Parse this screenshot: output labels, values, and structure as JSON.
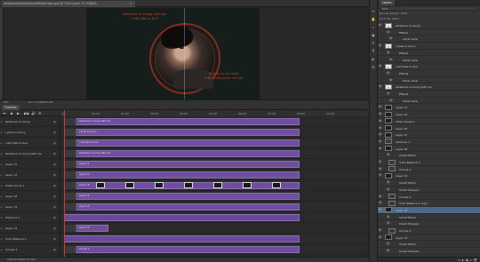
{
  "document": {
    "tab_title": "resistancefromtheeyetofthehorizon.psd @ 70% (Layer 13, RGB/8)",
    "close_glyph": "×"
  },
  "artwork": {
    "quote_top": "whatever is wrong with me\nI will take to bed",
    "quote_bottom": "lighter as we went\nwhere whatever we are"
  },
  "status": {
    "zoom": "70%",
    "doc": "Doc: 2.53M/92.1M"
  },
  "timeline": {
    "tab_label": "Timeline",
    "transport": [
      "⏮",
      "◀",
      "▶",
      "▶▶",
      "🔊",
      "⚙"
    ],
    "ruler_ticks": [
      "00",
      "01:00f",
      "02:00f",
      "03:00f",
      "04:00f",
      "05:00f",
      "06:00f",
      "07:00f",
      "08:00f",
      "09:00f"
    ],
    "time": "0:00:00:00",
    "fps": "(30.00 fps)",
    "tracks": [
      {
        "label": "whatever is wrong",
        "clip": "whatever is wrong with me"
      },
      {
        "label": "I grew to worry",
        "clip": "I grew to worry"
      },
      {
        "label": "I will take to bed",
        "clip": "I will take to bed"
      },
      {
        "label": "whatever is wrong with me",
        "clip": "whatever is wrong with me"
      },
      {
        "label": "Layer 11",
        "clip": "Layer 11"
      },
      {
        "label": "Layer 12",
        "clip": "Layer 12"
      },
      {
        "label": "Video Group 1",
        "clip": "Layer 18"
      },
      {
        "label": "Layer 16",
        "clip": "Layer 16"
      },
      {
        "label": "Layer 13",
        "clip": "Layer 13"
      },
      {
        "label": "Vibrance 1",
        "clip": ""
      },
      {
        "label": "Layer 14",
        "clip": "Layer 14"
      },
      {
        "label": "Color Balance 1",
        "clip": ""
      },
      {
        "label": "Curves 1",
        "clip": "Curves 1"
      }
    ]
  },
  "tools": [
    "↔",
    "✋",
    "⌕",
    "▣",
    "A",
    "¶",
    "◐",
    "⚙"
  ],
  "layers": {
    "tab_label": "Layers",
    "filter": "Kind",
    "blend": "Normal      Opacity: 100%",
    "lock": "Lock:        Fill: 100%",
    "footer": "fx  ◐  ▣  ▭  🗑",
    "rows": [
      {
        "name": "whatever is wrong",
        "indent": 0,
        "type": "text",
        "selected": false
      },
      {
        "name": "Effects",
        "indent": 1,
        "type": "fx",
        "selected": false
      },
      {
        "name": "Outer Glow",
        "indent": 2,
        "type": "fx",
        "selected": false
      },
      {
        "name": "I grew to worry",
        "indent": 0,
        "type": "text",
        "selected": false
      },
      {
        "name": "Effects",
        "indent": 1,
        "type": "fx",
        "selected": false
      },
      {
        "name": "Outer Glow",
        "indent": 2,
        "type": "fx",
        "selected": false
      },
      {
        "name": "I will take to bed",
        "indent": 0,
        "type": "text",
        "selected": false
      },
      {
        "name": "Effects",
        "indent": 1,
        "type": "fx",
        "selected": false
      },
      {
        "name": "Outer Glow",
        "indent": 2,
        "type": "fx",
        "selected": false
      },
      {
        "name": "whatever is wrong with me",
        "indent": 0,
        "type": "text",
        "selected": false
      },
      {
        "name": "Effects",
        "indent": 1,
        "type": "fx",
        "selected": false
      },
      {
        "name": "Outer Glow",
        "indent": 2,
        "type": "fx",
        "selected": false
      },
      {
        "name": "Layer 11",
        "indent": 0,
        "type": "image",
        "selected": false
      },
      {
        "name": "Layer 12",
        "indent": 0,
        "type": "image",
        "selected": false
      },
      {
        "name": "Video Group 1",
        "indent": 0,
        "type": "image",
        "selected": false
      },
      {
        "name": "Layer 16",
        "indent": 0,
        "type": "image",
        "selected": false
      },
      {
        "name": "Layer 17",
        "indent": 0,
        "type": "image",
        "selected": false
      },
      {
        "name": "Vibrance 1",
        "indent": 0,
        "type": "adjust",
        "selected": false
      },
      {
        "name": "Layer 18",
        "indent": 0,
        "type": "image",
        "selected": false
      },
      {
        "name": "Smart Filters",
        "indent": 1,
        "type": "fx",
        "selected": false
      },
      {
        "name": "Color Balance 1",
        "indent": 1,
        "type": "adjust",
        "selected": false
      },
      {
        "name": "Curves 1",
        "indent": 1,
        "type": "adjust",
        "selected": false
      },
      {
        "name": "Layer 15",
        "indent": 0,
        "type": "image",
        "selected": false
      },
      {
        "name": "Smart Filters",
        "indent": 1,
        "type": "fx",
        "selected": false
      },
      {
        "name": "Smart Sharpen",
        "indent": 1,
        "type": "fx",
        "selected": false
      },
      {
        "name": "Curves 2",
        "indent": 1,
        "type": "adjust",
        "selected": false
      },
      {
        "name": "Color Balance 1 copy",
        "indent": 1,
        "type": "adjust",
        "selected": false
      },
      {
        "name": "Layer 13",
        "indent": 0,
        "type": "image",
        "selected": true
      },
      {
        "name": "Smart Filters",
        "indent": 1,
        "type": "fx",
        "selected": false
      },
      {
        "name": "Smart Sharpen",
        "indent": 1,
        "type": "fx",
        "selected": false
      },
      {
        "name": "Curves 1",
        "indent": 1,
        "type": "adjust",
        "selected": false
      },
      {
        "name": "Layer 14",
        "indent": 0,
        "type": "image",
        "selected": false
      },
      {
        "name": "Smart Filters",
        "indent": 1,
        "type": "fx",
        "selected": false
      },
      {
        "name": "Smart Sharpen",
        "indent": 1,
        "type": "fx",
        "selected": false
      }
    ]
  }
}
